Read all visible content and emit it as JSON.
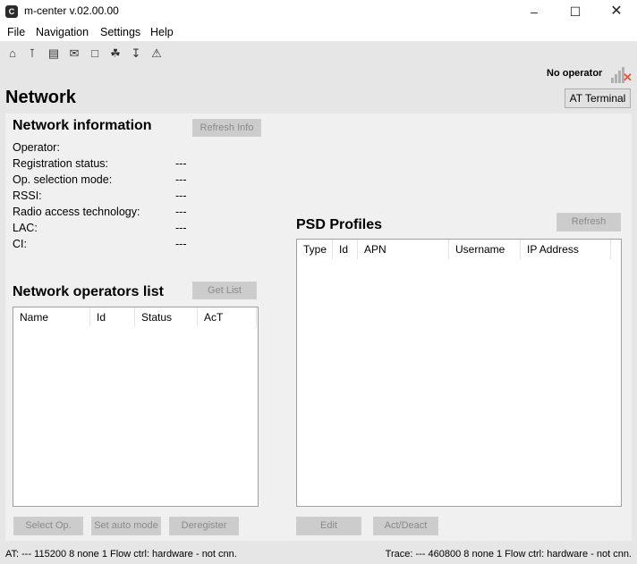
{
  "window": {
    "title": "m-center v.02.00.00",
    "app_icon": "C"
  },
  "menu": [
    "File",
    "Navigation",
    "Settings",
    "Help"
  ],
  "toolbar_icons": [
    "home-icon",
    "antenna-icon",
    "sim-card-icon",
    "mail-icon",
    "folder-icon",
    "satellite-icon",
    "download-icon",
    "warning-icon"
  ],
  "header": {
    "title": "Network",
    "operator_status": "No operator",
    "at_terminal": "AT Terminal"
  },
  "network_info": {
    "title": "Network information",
    "refresh": "Refresh Info",
    "rows": [
      {
        "label": "Operator:",
        "value": ""
      },
      {
        "label": "Registration status:",
        "value": "---"
      },
      {
        "label": "Op. selection mode:",
        "value": "---"
      },
      {
        "label": "RSSI:",
        "value": "---"
      },
      {
        "label": "Radio access technology:",
        "value": "---"
      },
      {
        "label": "LAC:",
        "value": "---"
      },
      {
        "label": "CI:",
        "value": "---"
      }
    ]
  },
  "operators": {
    "title": "Network operators list",
    "get_list": "Get List",
    "columns": [
      "Name",
      "Id",
      "Status",
      "AcT"
    ],
    "buttons": {
      "select": "Select Op.",
      "auto": "Set auto mode",
      "deregister": "Deregister"
    }
  },
  "psd": {
    "title": "PSD Profiles",
    "refresh": "Refresh",
    "columns": [
      "Type",
      "Id",
      "APN",
      "Username",
      "IP Address"
    ],
    "buttons": {
      "edit": "Edit",
      "actdeact": "Act/Deact"
    }
  },
  "status": {
    "left": "AT: --- 115200 8 none 1 Flow ctrl: hardware - not cnn.",
    "right": "Trace: --- 460800 8 none 1 Flow ctrl: hardware - not cnn."
  },
  "colors": {
    "chrome": "#e6e6e6",
    "panel": "#f0f0f0",
    "signal_x": "#e05a2b"
  }
}
